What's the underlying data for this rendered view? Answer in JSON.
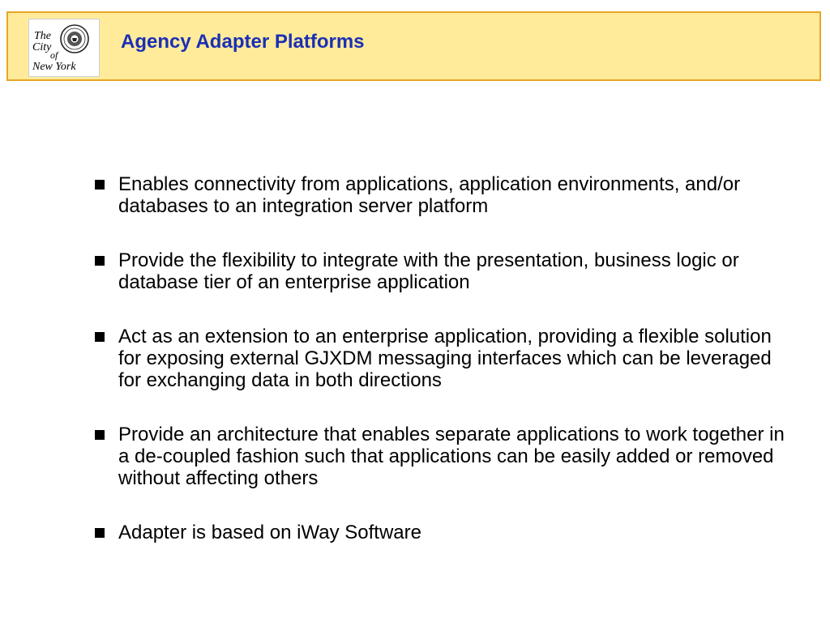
{
  "header": {
    "title": "Agency Adapter Platforms",
    "logo_alt": "The City of New York"
  },
  "bullets": [
    "Enables connectivity from applications, application environments, and/or databases to an integration server platform",
    "Provide the flexibility to integrate with the presentation, business logic or database tier of an enterprise application",
    "Act as an extension to an enterprise application, providing a flexible solution for exposing external GJXDM messaging interfaces which can be leveraged for exchanging data in both directions",
    "Provide an architecture that enables separate applications to work together in a de-coupled fashion such that applications can be easily added or removed without affecting others",
    "Adapter is based on iWay Software"
  ],
  "colors": {
    "header_bg": "#ffeb9a",
    "header_border": "#e9a527",
    "title": "#1b2fb6",
    "text": "#000000"
  }
}
